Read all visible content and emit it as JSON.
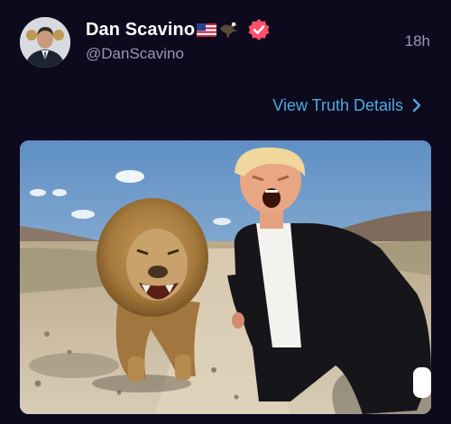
{
  "post": {
    "author": {
      "display_name": "Dan Scavino",
      "name_emoji": [
        "us-flag-icon",
        "eagle-icon"
      ],
      "handle": "@DanScavino",
      "verified": true
    },
    "timestamp": "18h",
    "view_details_label": "View Truth Details",
    "media": {
      "type": "image",
      "description_icon": "photo-lion-and-man-selfie"
    }
  },
  "colors": {
    "background": "#0c0a1c",
    "link": "#4fa9e0",
    "verified_badge": "#ff4f6d",
    "secondary_text": "#9a97b0"
  }
}
